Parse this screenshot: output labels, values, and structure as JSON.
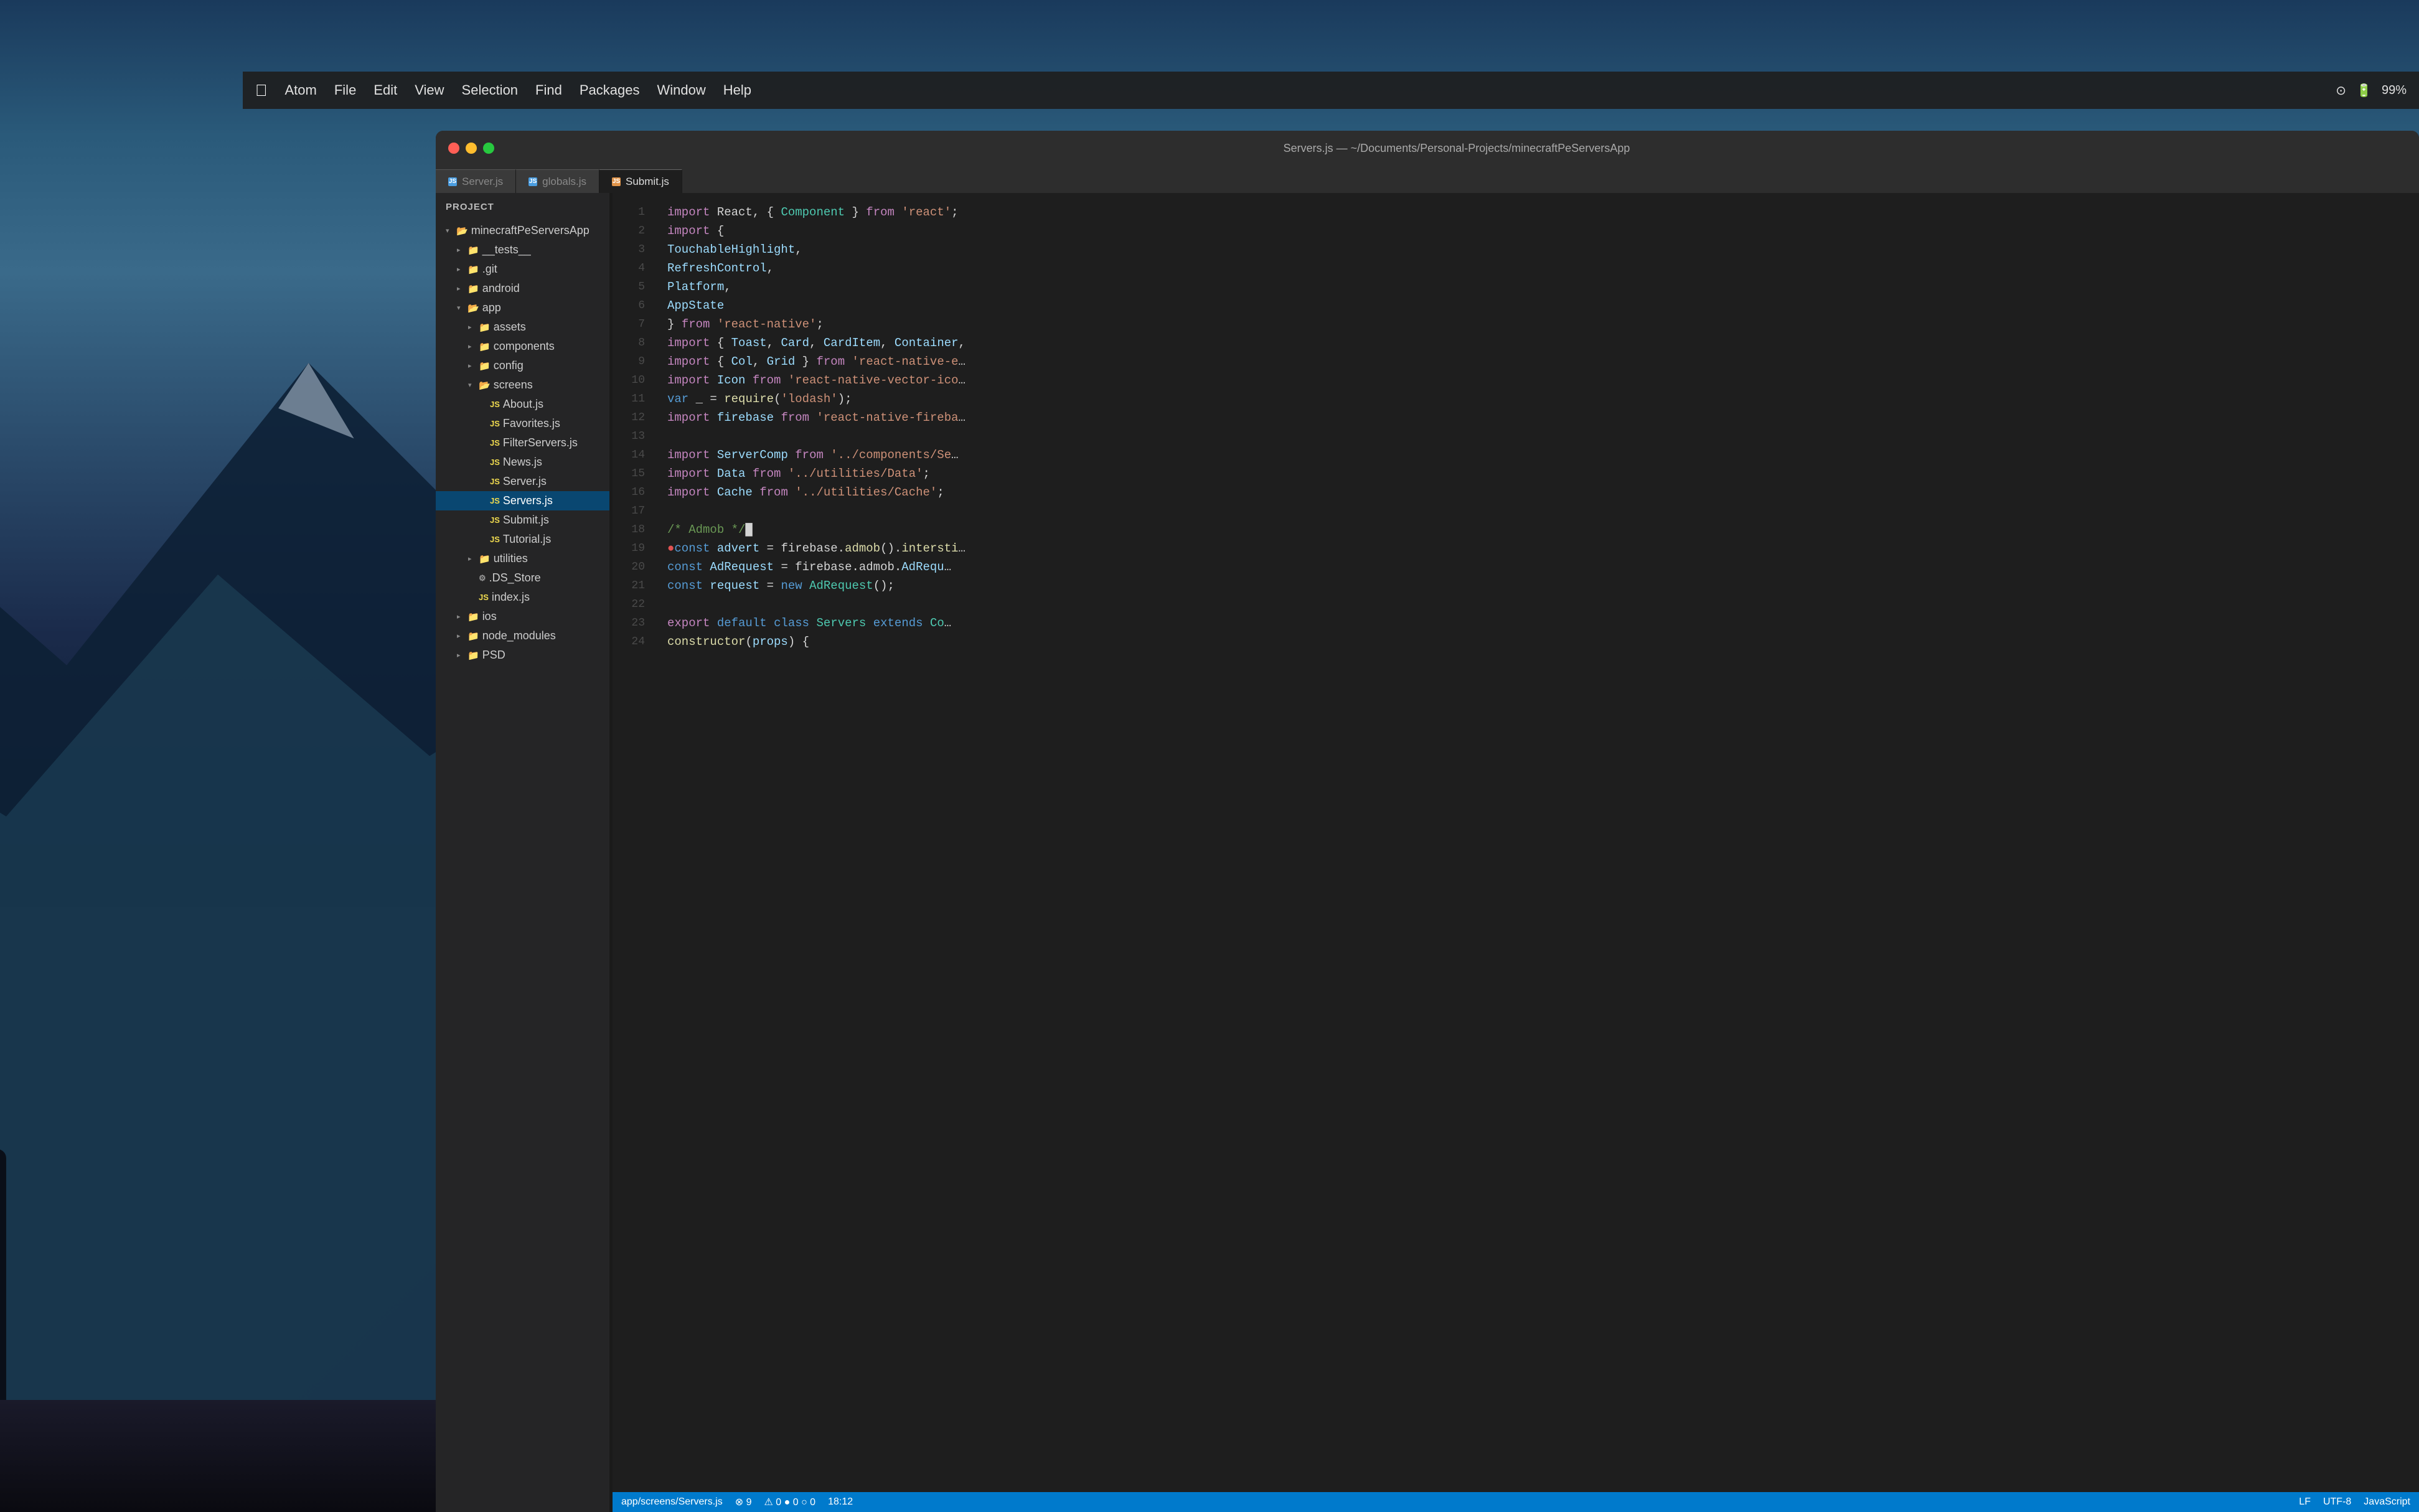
{
  "background": {
    "description": "Laptop on desk with mountain wallpaper"
  },
  "menubar": {
    "items": [
      "",
      "Atom",
      "File",
      "Edit",
      "View",
      "Selection",
      "Find",
      "Packages",
      "Window",
      "Help"
    ],
    "right_items": [
      "99%"
    ]
  },
  "title_bar": {
    "text": "Servers.js — ~/Documents/Personal-Projects/minecraftPeServersApp",
    "traffic_lights": [
      "red",
      "yellow",
      "green"
    ]
  },
  "tabs": [
    {
      "name": "Server.js",
      "icon": "js",
      "active": false
    },
    {
      "name": "globals.js",
      "icon": "js",
      "active": false
    },
    {
      "name": "Submit.js",
      "icon": "js",
      "active": true
    }
  ],
  "sidebar": {
    "header": "Project",
    "tree": [
      {
        "indent": 0,
        "type": "folder",
        "open": true,
        "name": "minecraftPeServersApp"
      },
      {
        "indent": 1,
        "type": "folder",
        "open": false,
        "name": "__tests__"
      },
      {
        "indent": 1,
        "type": "folder",
        "open": false,
        "name": ".git"
      },
      {
        "indent": 1,
        "type": "folder",
        "open": false,
        "name": "android"
      },
      {
        "indent": 1,
        "type": "folder",
        "open": true,
        "name": "app"
      },
      {
        "indent": 2,
        "type": "folder",
        "open": false,
        "name": "assets"
      },
      {
        "indent": 2,
        "type": "folder",
        "open": false,
        "name": "components"
      },
      {
        "indent": 2,
        "type": "folder",
        "open": false,
        "name": "config"
      },
      {
        "indent": 2,
        "type": "folder",
        "open": true,
        "name": "screens"
      },
      {
        "indent": 3,
        "type": "file",
        "name": "About.js"
      },
      {
        "indent": 3,
        "type": "file",
        "name": "Favorites.js"
      },
      {
        "indent": 3,
        "type": "file",
        "name": "FilterServers.js"
      },
      {
        "indent": 3,
        "type": "file",
        "name": "News.js"
      },
      {
        "indent": 3,
        "type": "file",
        "name": "Server.js"
      },
      {
        "indent": 3,
        "type": "file",
        "name": "Servers.js",
        "selected": true
      },
      {
        "indent": 3,
        "type": "file",
        "name": "Submit.js"
      },
      {
        "indent": 3,
        "type": "file",
        "name": "Tutorial.js"
      },
      {
        "indent": 2,
        "type": "folder",
        "open": false,
        "name": "utilities"
      },
      {
        "indent": 2,
        "type": "file-ds",
        "name": ".DS_Store"
      },
      {
        "indent": 2,
        "type": "file",
        "name": "index.js"
      },
      {
        "indent": 1,
        "type": "folder",
        "open": false,
        "name": "ios"
      },
      {
        "indent": 1,
        "type": "folder",
        "open": false,
        "name": "node_modules"
      },
      {
        "indent": 1,
        "type": "folder",
        "open": false,
        "name": "PSD"
      }
    ]
  },
  "code": {
    "lines": [
      {
        "num": 1,
        "tokens": [
          {
            "t": "kw2",
            "v": "import"
          },
          {
            "t": "plain",
            "v": " React, { "
          },
          {
            "t": "cls",
            "v": "Component"
          },
          {
            "t": "plain",
            "v": " } "
          },
          {
            "t": "kw2",
            "v": "from"
          },
          {
            "t": "plain",
            "v": " "
          },
          {
            "t": "str",
            "v": "'react'"
          },
          {
            "t": "plain",
            "v": ";"
          }
        ]
      },
      {
        "num": 2,
        "tokens": [
          {
            "t": "kw2",
            "v": "import"
          },
          {
            "t": "plain",
            "v": " {"
          }
        ]
      },
      {
        "num": 3,
        "tokens": [
          {
            "t": "plain",
            "v": "    "
          },
          {
            "t": "prop",
            "v": "TouchableHighlight"
          },
          {
            "t": "plain",
            "v": ","
          }
        ]
      },
      {
        "num": 4,
        "tokens": [
          {
            "t": "plain",
            "v": "    "
          },
          {
            "t": "prop",
            "v": "RefreshControl"
          },
          {
            "t": "plain",
            "v": ","
          }
        ]
      },
      {
        "num": 5,
        "tokens": [
          {
            "t": "plain",
            "v": "    "
          },
          {
            "t": "prop",
            "v": "Platform"
          },
          {
            "t": "plain",
            "v": ","
          }
        ]
      },
      {
        "num": 6,
        "tokens": [
          {
            "t": "plain",
            "v": "    "
          },
          {
            "t": "prop",
            "v": "AppState"
          }
        ]
      },
      {
        "num": 7,
        "tokens": [
          {
            "t": "plain",
            "v": "} "
          },
          {
            "t": "kw2",
            "v": "from"
          },
          {
            "t": "plain",
            "v": " "
          },
          {
            "t": "str",
            "v": "'react-native'"
          },
          {
            "t": "plain",
            "v": ";"
          }
        ]
      },
      {
        "num": 8,
        "tokens": [
          {
            "t": "kw2",
            "v": "import"
          },
          {
            "t": "plain",
            "v": " { "
          },
          {
            "t": "prop",
            "v": "Toast"
          },
          {
            "t": "plain",
            "v": ", "
          },
          {
            "t": "prop",
            "v": "Card"
          },
          {
            "t": "plain",
            "v": ", "
          },
          {
            "t": "prop",
            "v": "CardItem"
          },
          {
            "t": "plain",
            "v": ", "
          },
          {
            "t": "prop",
            "v": "Container"
          },
          {
            "t": "plain",
            "v": ","
          }
        ]
      },
      {
        "num": 9,
        "tokens": [
          {
            "t": "kw2",
            "v": "import"
          },
          {
            "t": "plain",
            "v": " { "
          },
          {
            "t": "prop",
            "v": "Col"
          },
          {
            "t": "plain",
            "v": ", "
          },
          {
            "t": "prop",
            "v": "Grid"
          },
          {
            "t": "plain",
            "v": " } "
          },
          {
            "t": "kw2",
            "v": "from"
          },
          {
            "t": "plain",
            "v": " "
          },
          {
            "t": "str",
            "v": "'react-native-e"
          },
          {
            "t": "plain",
            "v": "…"
          }
        ]
      },
      {
        "num": 10,
        "tokens": [
          {
            "t": "kw2",
            "v": "import"
          },
          {
            "t": "plain",
            "v": " "
          },
          {
            "t": "prop",
            "v": "Icon"
          },
          {
            "t": "plain",
            "v": " "
          },
          {
            "t": "kw2",
            "v": "from"
          },
          {
            "t": "plain",
            "v": " "
          },
          {
            "t": "str",
            "v": "'react-native-vector-ico"
          },
          {
            "t": "plain",
            "v": "…"
          }
        ]
      },
      {
        "num": 11,
        "tokens": [
          {
            "t": "kw",
            "v": "var"
          },
          {
            "t": "plain",
            "v": " _ = "
          },
          {
            "t": "fn",
            "v": "require"
          },
          {
            "t": "plain",
            "v": "("
          },
          {
            "t": "str",
            "v": "'lodash'"
          },
          {
            "t": "plain",
            "v": ");"
          }
        ]
      },
      {
        "num": 12,
        "tokens": [
          {
            "t": "kw2",
            "v": "import"
          },
          {
            "t": "plain",
            "v": " "
          },
          {
            "t": "prop",
            "v": "firebase"
          },
          {
            "t": "plain",
            "v": " "
          },
          {
            "t": "kw2",
            "v": "from"
          },
          {
            "t": "plain",
            "v": " "
          },
          {
            "t": "str",
            "v": "'react-native-fireba"
          },
          {
            "t": "plain",
            "v": "…"
          }
        ]
      },
      {
        "num": 13,
        "tokens": []
      },
      {
        "num": 14,
        "tokens": [
          {
            "t": "kw2",
            "v": "import"
          },
          {
            "t": "plain",
            "v": " "
          },
          {
            "t": "prop",
            "v": "ServerComp"
          },
          {
            "t": "plain",
            "v": " "
          },
          {
            "t": "kw2",
            "v": "from"
          },
          {
            "t": "plain",
            "v": " "
          },
          {
            "t": "str",
            "v": "'../components/Se"
          },
          {
            "t": "plain",
            "v": "…"
          }
        ]
      },
      {
        "num": 15,
        "tokens": [
          {
            "t": "kw2",
            "v": "import"
          },
          {
            "t": "plain",
            "v": " "
          },
          {
            "t": "prop",
            "v": "Data"
          },
          {
            "t": "plain",
            "v": " "
          },
          {
            "t": "kw2",
            "v": "from"
          },
          {
            "t": "plain",
            "v": " "
          },
          {
            "t": "str",
            "v": "'../utilities/Data'"
          },
          {
            "t": "plain",
            "v": ";"
          }
        ]
      },
      {
        "num": 16,
        "tokens": [
          {
            "t": "kw2",
            "v": "import"
          },
          {
            "t": "plain",
            "v": " "
          },
          {
            "t": "prop",
            "v": "Cache"
          },
          {
            "t": "plain",
            "v": " "
          },
          {
            "t": "kw2",
            "v": "from"
          },
          {
            "t": "plain",
            "v": " "
          },
          {
            "t": "str",
            "v": "'../utilities/Cache'"
          },
          {
            "t": "plain",
            "v": ";"
          }
        ]
      },
      {
        "num": 17,
        "tokens": []
      },
      {
        "num": 18,
        "tokens": [
          {
            "t": "comment",
            "v": "/* Admob */"
          },
          {
            "t": "plain",
            "v": "█"
          }
        ]
      },
      {
        "num": 19,
        "tokens": [
          {
            "t": "red-dot",
            "v": "●"
          },
          {
            "t": "kw",
            "v": "const"
          },
          {
            "t": "plain",
            "v": " "
          },
          {
            "t": "var",
            "v": "advert"
          },
          {
            "t": "plain",
            "v": " = firebase."
          },
          {
            "t": "fn",
            "v": "admob"
          },
          {
            "t": "plain",
            "v": "()."
          },
          {
            "t": "fn",
            "v": "intersti"
          },
          {
            "t": "plain",
            "v": "…"
          }
        ]
      },
      {
        "num": 20,
        "tokens": [
          {
            "t": "kw",
            "v": "const"
          },
          {
            "t": "plain",
            "v": " "
          },
          {
            "t": "var",
            "v": "AdRequest"
          },
          {
            "t": "plain",
            "v": " = firebase.admob."
          },
          {
            "t": "prop",
            "v": "AdRequ"
          },
          {
            "t": "plain",
            "v": "…"
          }
        ]
      },
      {
        "num": 21,
        "tokens": [
          {
            "t": "kw",
            "v": "const"
          },
          {
            "t": "plain",
            "v": " "
          },
          {
            "t": "var",
            "v": "request"
          },
          {
            "t": "plain",
            "v": " = "
          },
          {
            "t": "kw",
            "v": "new"
          },
          {
            "t": "plain",
            "v": " "
          },
          {
            "t": "cls",
            "v": "AdRequest"
          },
          {
            "t": "plain",
            "v": "();"
          }
        ]
      },
      {
        "num": 22,
        "tokens": []
      },
      {
        "num": 23,
        "tokens": [
          {
            "t": "kw2",
            "v": "export"
          },
          {
            "t": "plain",
            "v": " "
          },
          {
            "t": "kw",
            "v": "default"
          },
          {
            "t": "plain",
            "v": " "
          },
          {
            "t": "kw",
            "v": "class"
          },
          {
            "t": "plain",
            "v": " "
          },
          {
            "t": "cls",
            "v": "Servers"
          },
          {
            "t": "plain",
            "v": " "
          },
          {
            "t": "kw",
            "v": "extends"
          },
          {
            "t": "plain",
            "v": " "
          },
          {
            "t": "cls",
            "v": "Co"
          },
          {
            "t": "plain",
            "v": "…"
          }
        ]
      },
      {
        "num": 24,
        "tokens": [
          {
            "t": "plain",
            "v": "    "
          },
          {
            "t": "fn",
            "v": "constructor"
          },
          {
            "t": "plain",
            "v": "("
          },
          {
            "t": "var",
            "v": "props"
          },
          {
            "t": "plain",
            "v": ") {"
          }
        ]
      }
    ]
  },
  "status_bar": {
    "left": [
      "app/screens/Servers.js",
      "⊗ 9",
      "⚠ 0 ● 0 ○ 0",
      "18:12"
    ],
    "right": [
      "LF",
      "UTF-8",
      "JavaScript"
    ]
  }
}
